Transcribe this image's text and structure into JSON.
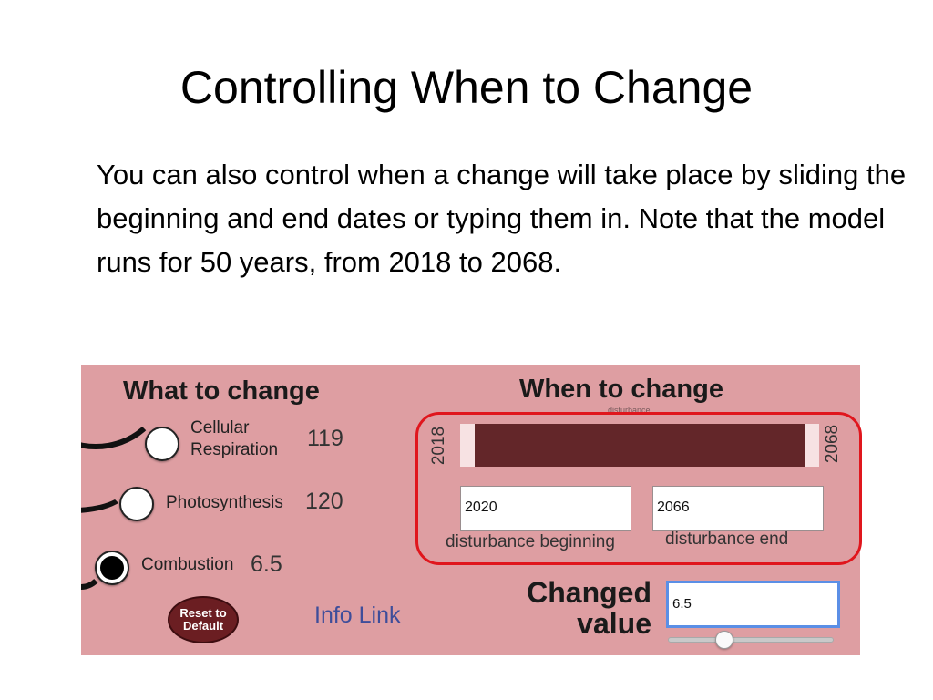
{
  "slide": {
    "title": "Controlling When to Change",
    "body": "You can also control when a change will take place by sliding the beginning and end dates or typing them in. Note that the model runs for 50 years, from 2018 to 2068."
  },
  "panel": {
    "what_heading": "What to change",
    "options": [
      {
        "label_line1": "Cellular",
        "label_line2": "Respiration",
        "value": "119",
        "checked": false
      },
      {
        "label": "Photosynthesis",
        "value": "120",
        "checked": false
      },
      {
        "label": "Combustion",
        "value": "6.5",
        "checked": true
      }
    ],
    "reset_line1": "Reset to",
    "reset_line2": "Default",
    "info_link": "Info Link",
    "when_heading": "When to change",
    "disturbance_tiny": "disturbance",
    "start_year": "2018",
    "end_year": "2068",
    "range_start_fraction": 0.04,
    "range_end_fraction": 0.96,
    "beginning_value": "2020",
    "end_value": "2066",
    "beginning_caption": "disturbance beginning",
    "end_caption": "disturbance end",
    "changed_line1": "Changed",
    "changed_line2": "value",
    "changed_value": "6.5",
    "value_slider_fraction": 0.34,
    "colors": {
      "panel_bg": "#de9ea2",
      "range_fill": "#632629",
      "highlight_border": "#e0161d",
      "link": "#3e4d9a",
      "focus_border": "#5b8fe6"
    }
  }
}
